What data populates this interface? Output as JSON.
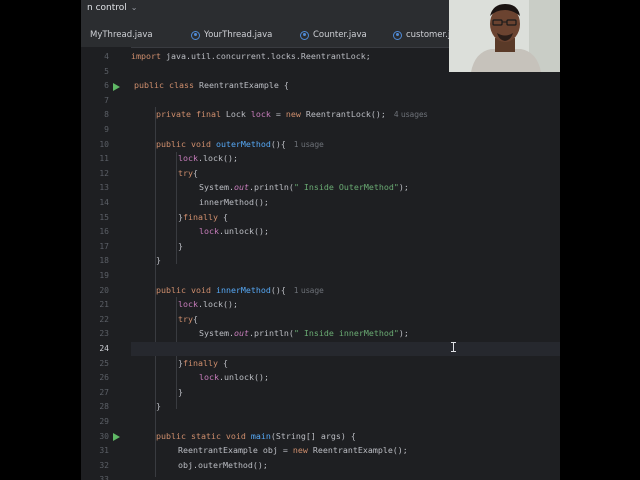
{
  "window": {
    "title": "n control"
  },
  "tabs": [
    {
      "label": "MyThread.java"
    },
    {
      "label": "YourThread.java"
    },
    {
      "label": "Counter.java"
    },
    {
      "label": "customer.j"
    }
  ],
  "gutter": {
    "lines": [
      "4",
      "5",
      "6",
      "7",
      "8",
      "9",
      "10",
      "11",
      "12",
      "13",
      "14",
      "15",
      "16",
      "17",
      "18",
      "19",
      "20",
      "21",
      "22",
      "23",
      "24",
      "25",
      "26",
      "27",
      "28",
      "29",
      "30",
      "31",
      "32",
      "33"
    ],
    "current_line": "24",
    "run_lines": [
      "6",
      "30"
    ]
  },
  "code": {
    "l4": {
      "kw": "import",
      "rest": " java.util.concurrent.locks.ReentrantLock;"
    },
    "l6": {
      "kw": "public class",
      "rest": " ReentrantExample {"
    },
    "l8": {
      "kw": "private final",
      "type": " Lock ",
      "field": "lock",
      "eq": " = ",
      "new": "new",
      "rest": " ReentrantLock();",
      "hint": "4 usages"
    },
    "l10": {
      "kw": "public void",
      "fn": "outerMethod",
      "rest": "(){",
      "hint": "1 usage"
    },
    "l11": {
      "field": "lock",
      "rest": ".lock();"
    },
    "l12": {
      "kw": "try",
      "rest": "{"
    },
    "l13": {
      "pre": "System.",
      "st": "out",
      "mid": ".println(",
      "str": "\" Inside OuterMethod\"",
      "rest": ");"
    },
    "l14": {
      "rest": "innerMethod();"
    },
    "l15": {
      "pre": "}",
      "kw": "finally",
      "rest": " {"
    },
    "l16": {
      "field": "lock",
      "rest": ".unlock();"
    },
    "l17": {
      "rest": "}"
    },
    "l18": {
      "rest": "}"
    },
    "l20": {
      "kw": "public void",
      "fn": "innerMethod",
      "rest": "(){",
      "hint": "1 usage"
    },
    "l21": {
      "field": "lock",
      "rest": ".lock();"
    },
    "l22": {
      "kw": "try",
      "rest": "{"
    },
    "l23": {
      "pre": "System.",
      "st": "out",
      "mid": ".println(",
      "str": "\" Inside innerMethod\"",
      "rest": ");"
    },
    "l25": {
      "pre": "}",
      "kw": "finally",
      "rest": " {"
    },
    "l26": {
      "field": "lock",
      "rest": ".unlock();"
    },
    "l27": {
      "rest": "}"
    },
    "l28": {
      "rest": "}"
    },
    "l30": {
      "kw": "public static void",
      "fn": "main",
      "rest": "(String[] args) {"
    },
    "l31": {
      "pre": "ReentrantExample obj = ",
      "new": "new",
      "rest": " ReentrantExample();"
    },
    "l32": {
      "rest": "obj.outerMethod();"
    }
  },
  "webcam": {
    "description_icon": "webcam-person-icon"
  },
  "colors": {
    "editor_bg": "#1e1f22",
    "keyword": "#cf8e6d",
    "function": "#56a8f5",
    "field": "#c77dbb",
    "string": "#6aab73"
  }
}
